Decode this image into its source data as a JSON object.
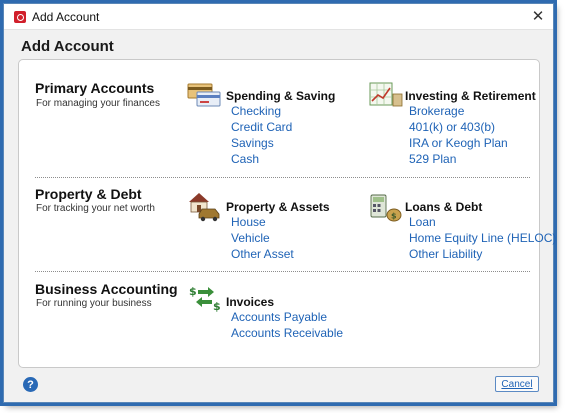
{
  "window": {
    "title": "Add Account",
    "heading": "Add Account",
    "close_glyph": "✕"
  },
  "sections": {
    "primary": {
      "title": "Primary Accounts",
      "subtitle": "For managing your finances",
      "spending": {
        "icon": "spending-saving-icon",
        "title": "Spending & Saving",
        "links": [
          "Checking",
          "Credit Card",
          "Savings",
          "Cash"
        ]
      },
      "investing": {
        "icon": "investing-chart-icon",
        "title": "Investing & Retirement",
        "links": [
          "Brokerage",
          "401(k) or 403(b)",
          "IRA or Keogh Plan",
          "529 Plan"
        ]
      }
    },
    "property": {
      "title": "Property & Debt",
      "subtitle": "For tracking your net worth",
      "assets": {
        "icon": "house-car-icon",
        "title": "Property & Assets",
        "links": [
          "House",
          "Vehicle",
          "Other Asset"
        ]
      },
      "loans": {
        "icon": "calculator-money-icon",
        "title": "Loans & Debt",
        "links": [
          "Loan",
          "Home Equity Line (HELOC)",
          "Other Liability"
        ]
      }
    },
    "business": {
      "title": "Business Accounting",
      "subtitle": "For running your business",
      "invoices": {
        "icon": "invoice-dollar-icon",
        "title": "Invoices",
        "links": [
          "Accounts Payable",
          "Accounts Receivable"
        ]
      }
    }
  },
  "footer": {
    "help_glyph": "?",
    "cancel_label": "Cancel"
  },
  "colors": {
    "link": "#1f63b6",
    "window_border": "#2f6bb0",
    "app_icon": "#d11f2b"
  }
}
